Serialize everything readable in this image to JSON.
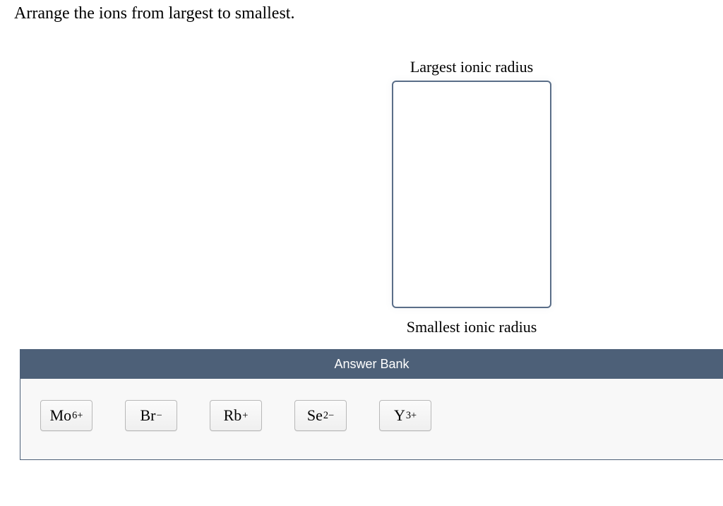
{
  "question": "Arrange the ions from largest to smallest.",
  "drop_zone": {
    "top_label": "Largest ionic radius",
    "bottom_label": "Smallest ionic radius"
  },
  "answer_bank": {
    "header": "Answer Bank",
    "ions": [
      {
        "base": "Mo",
        "sup": "6+"
      },
      {
        "base": "Br",
        "sup": "−"
      },
      {
        "base": "Rb",
        "sup": "+"
      },
      {
        "base": "Se",
        "sup": "2−"
      },
      {
        "base": "Y",
        "sup": "3+"
      }
    ]
  }
}
